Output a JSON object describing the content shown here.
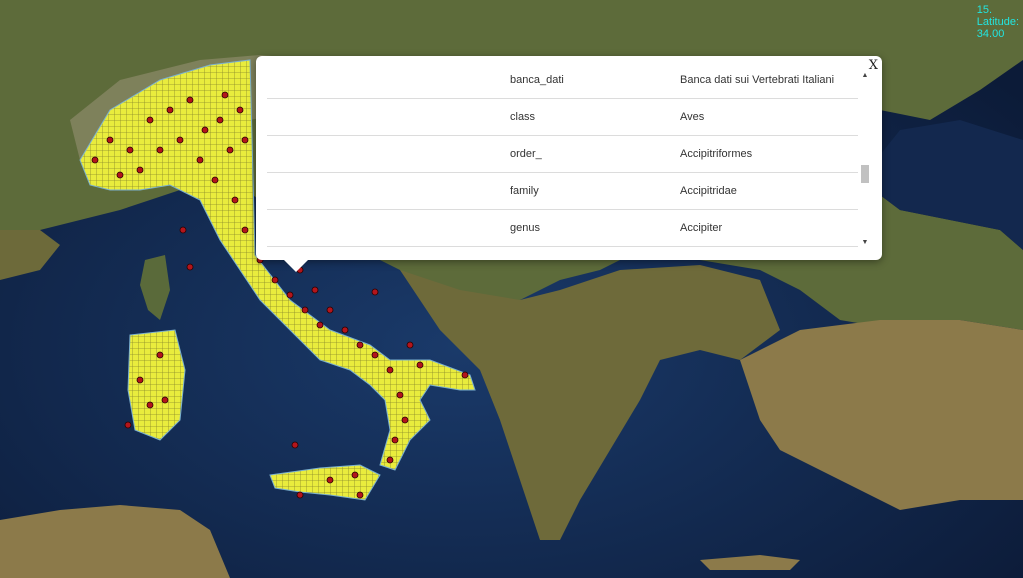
{
  "coordinates": {
    "line1": "15.",
    "latitude_label": "Latitude:",
    "latitude_value": "34.00"
  },
  "popup": {
    "close_label": "X",
    "rows": [
      {
        "key": "banca_dati",
        "value": "Banca dati sui Vertebrati Italiani"
      },
      {
        "key": "class",
        "value": "Aves"
      },
      {
        "key": "order_",
        "value": "Accipitriformes"
      },
      {
        "key": "family",
        "value": "Accipitridae"
      },
      {
        "key": "genus",
        "value": "Accipiter"
      }
    ]
  },
  "colors": {
    "sea": "#0f2140",
    "land": "#6b6b3a",
    "grid": "#e6ea3a",
    "point": "#b3151b",
    "label": "#22e5e0"
  }
}
